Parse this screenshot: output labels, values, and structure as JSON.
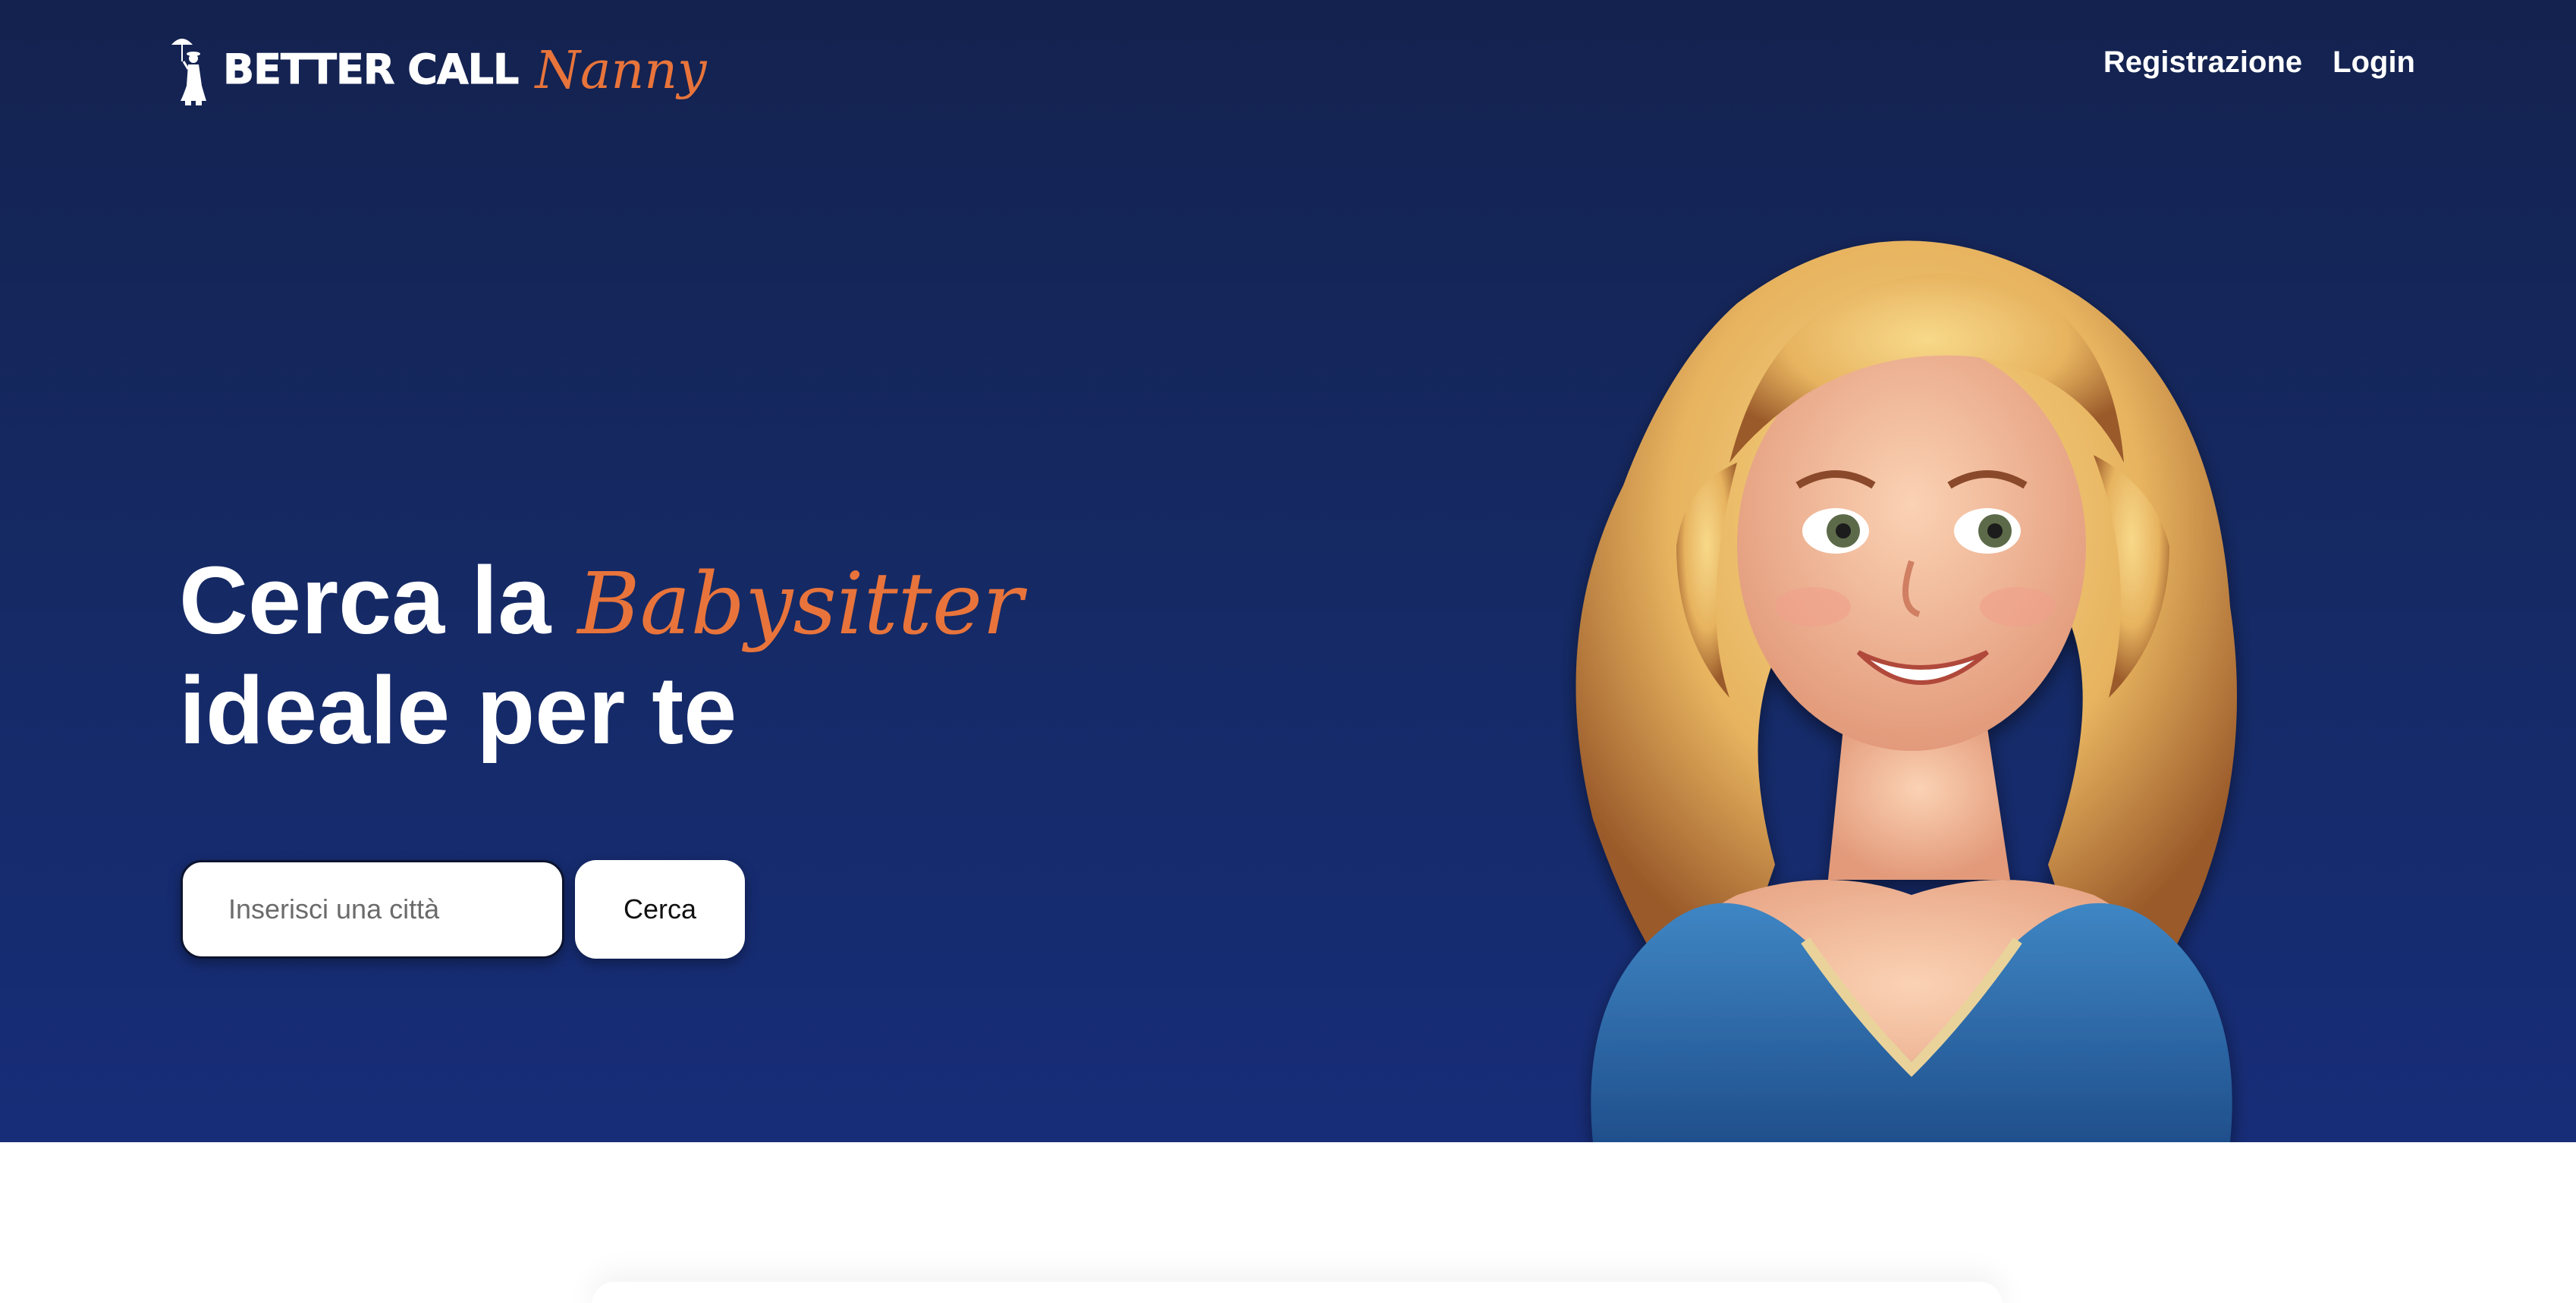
{
  "brand": {
    "name_bold": "BETTER CALL",
    "name_script": "Nanny",
    "figure_icon": "nanny-umbrella-icon",
    "accent_color": "#e8743b"
  },
  "nav": {
    "links": [
      {
        "label": "Registrazione"
      },
      {
        "label": "Login"
      }
    ]
  },
  "hero": {
    "headline_prefix": "Cerca la",
    "headline_accent": "Babysitter",
    "headline_line2": "ideale per te",
    "background_color": "#152a66",
    "illustration": "babysitter-illustration"
  },
  "search": {
    "placeholder": "Inserisci una città",
    "value": "",
    "button_label": "Cerca"
  }
}
